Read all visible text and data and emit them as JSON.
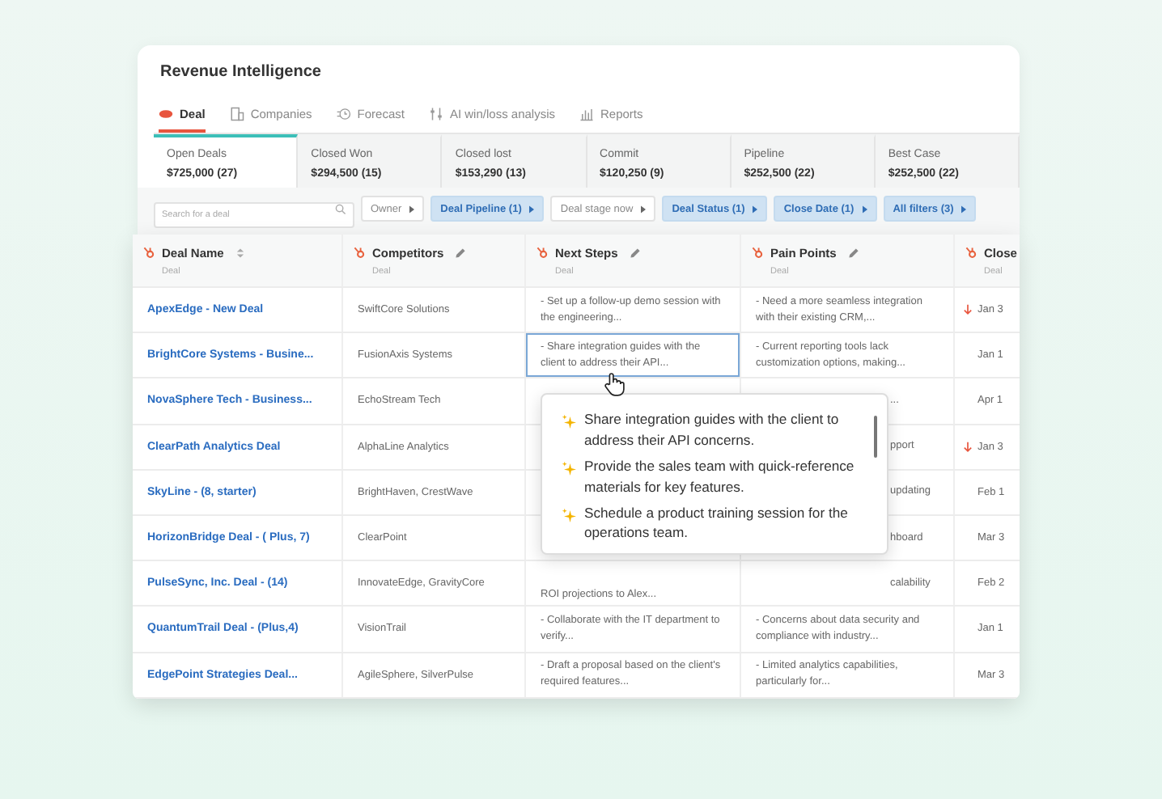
{
  "app_title": "Revenue Intelligence",
  "tabs": [
    {
      "label": "Deal",
      "selected": true
    },
    {
      "label": "Companies",
      "selected": false
    },
    {
      "label": "Forecast",
      "selected": false
    },
    {
      "label": "AI win/loss analysis",
      "selected": false
    },
    {
      "label": "Reports",
      "selected": false
    }
  ],
  "metrics": [
    {
      "label": "Open Deals",
      "value": "$725,000 (27)",
      "selected": true
    },
    {
      "label": "Closed Won",
      "value": "$294,500 (15)",
      "selected": false
    },
    {
      "label": "Closed lost",
      "value": "$153,290 (13)",
      "selected": false
    },
    {
      "label": "Commit",
      "value": "$120,250 (9)",
      "selected": false
    },
    {
      "label": "Pipeline",
      "value": "$252,500 (22)",
      "selected": false
    },
    {
      "label": "Best Case",
      "value": "$252,500 (22)",
      "selected": false
    }
  ],
  "search": {
    "placeholder": "Search for a deal"
  },
  "filters": [
    {
      "label": "Owner",
      "active": false
    },
    {
      "label": "Deal Pipeline (1)",
      "active": true
    },
    {
      "label": "Deal stage now",
      "active": false
    },
    {
      "label": "Deal Status (1)",
      "active": true
    },
    {
      "label": "Close Date (1)",
      "active": true
    },
    {
      "label": "All filters (3)",
      "active": true
    }
  ],
  "table": {
    "columns": [
      {
        "title": "Deal Name",
        "subtitle": "Deal"
      },
      {
        "title": "Competitors",
        "subtitle": "Deal"
      },
      {
        "title": "Next Steps",
        "subtitle": "Deal"
      },
      {
        "title": "Pain Points",
        "subtitle": "Deal"
      },
      {
        "title": "Close",
        "subtitle": "Deal"
      }
    ],
    "rows": [
      {
        "deal_name": "ApexEdge - New Deal",
        "competitors": "SwiftCore Solutions",
        "next_steps": "- Set up a follow-up demo session with the engineering...",
        "pain_points": "- Need a more seamless integration with their existing CRM,...",
        "close": "Jan 3",
        "overdue": true,
        "focused": false
      },
      {
        "deal_name": "BrightCore Systems - Busine...",
        "competitors": "FusionAxis Systems",
        "next_steps": "- Share integration guides with the client to address their API...",
        "pain_points": "- Current reporting tools lack customization options, making...",
        "close": "Jan 1",
        "overdue": false,
        "focused": true
      },
      {
        "deal_name": "NovaSphere Tech - Business...",
        "competitors": "EchoStream Tech",
        "pain_points": "...",
        "pain_covered": true,
        "close": "Apr 1",
        "overdue": false,
        "focused": false
      },
      {
        "deal_name": "ClearPath Analytics Deal",
        "competitors": "AlphaLine Analytics",
        "pain_points": "pport",
        "pain_covered": true,
        "close": "Jan 3",
        "overdue": true,
        "focused": false
      },
      {
        "deal_name": "SkyLine - (8, starter)",
        "competitors": "BrightHaven, CrestWave",
        "pain_points": "updating",
        "pain_covered": true,
        "close": "Feb 1",
        "overdue": false,
        "focused": false
      },
      {
        "deal_name": "HorizonBridge Deal - ( Plus, 7)",
        "competitors": "ClearPoint",
        "pain_points": "hboard",
        "pain_covered": true,
        "close": "Mar 3",
        "overdue": false,
        "focused": false
      },
      {
        "deal_name": "PulseSync, Inc. Deal - (14)",
        "competitors": "InnovateEdge, GravityCore",
        "next_steps": "ROI projections to Alex...",
        "next_covered": true,
        "pain_points": "calability",
        "pain_covered": true,
        "close": "Feb 2",
        "overdue": false,
        "focused": false
      },
      {
        "deal_name": "QuantumTrail Deal - (Plus,4)",
        "competitors": "VisionTrail",
        "next_steps": "- Collaborate with the IT department to verify...",
        "pain_points": "- Concerns about data security and compliance with industry...",
        "close": "Jan 1",
        "overdue": false,
        "focused": false
      },
      {
        "deal_name": "EdgePoint Strategies Deal...",
        "competitors": "AgileSphere, SilverPulse",
        "next_steps": "- Draft a proposal based on the client's required features...",
        "pain_points": "- Limited analytics capabilities, particularly for...",
        "close": "Mar 3",
        "overdue": false,
        "focused": false
      }
    ]
  },
  "popover": {
    "items": [
      "Share integration guides with the client to address their API concerns.",
      "Provide the sales team with quick-reference materials for key features.",
      "Schedule a product training session for the operations team."
    ]
  }
}
